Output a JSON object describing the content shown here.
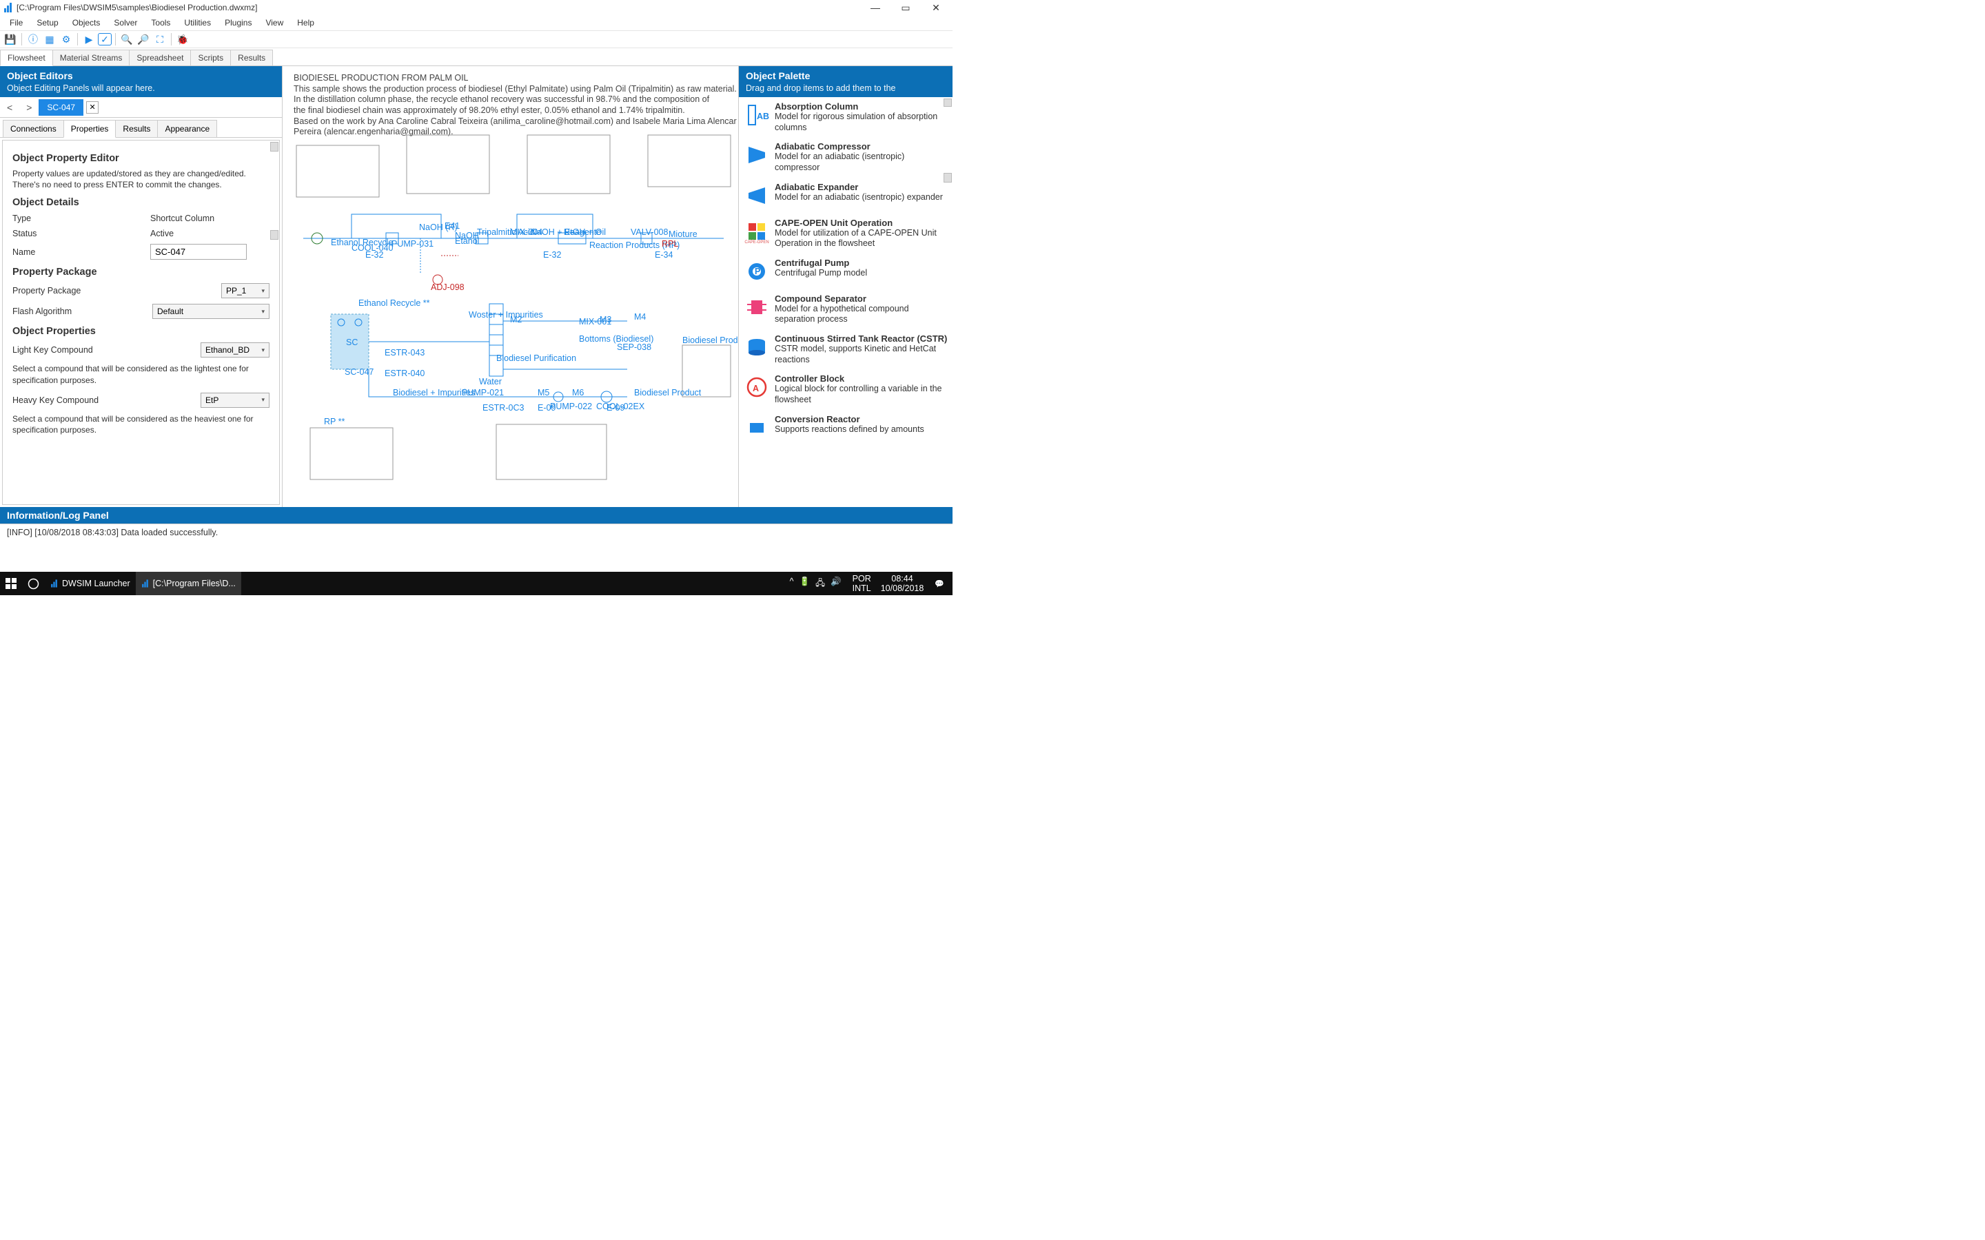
{
  "window": {
    "title": "[C:\\Program Files\\DWSIM5\\samples\\Biodiesel Production.dwxmz]"
  },
  "menu": [
    "File",
    "Setup",
    "Objects",
    "Solver",
    "Tools",
    "Utilities",
    "Plugins",
    "View",
    "Help"
  ],
  "doc_tabs": [
    "Flowsheet",
    "Material Streams",
    "Spreadsheet",
    "Scripts",
    "Results"
  ],
  "doc_active": "Flowsheet",
  "editor": {
    "header": "Object Editors",
    "sub": "Object Editing Panels will appear here.",
    "obj_tab": "SC-047",
    "sub_tabs": [
      "Connections",
      "Properties",
      "Results",
      "Appearance"
    ],
    "sub_active": "Properties",
    "title": "Object Property Editor",
    "help": "Property values are updated/stored as they are changed/edited. There's no need to press ENTER to commit the changes.",
    "details_h": "Object Details",
    "type_l": "Type",
    "type_v": "Shortcut Column",
    "status_l": "Status",
    "status_v": "Active",
    "name_l": "Name",
    "name_v": "SC-047",
    "pkg_h": "Property Package",
    "pkg_l": "Property Package",
    "pkg_v": "PP_1",
    "flash_l": "Flash Algorithm",
    "flash_v": "Default",
    "objprops_h": "Object Properties",
    "lk_l": "Light Key Compound",
    "lk_v": "Ethanol_BD",
    "lk_help": "Select a compound that will be considered as the lightest one for specification purposes.",
    "hk_l": "Heavy Key Compound",
    "hk_v": "EtP",
    "hk_help": "Select a compound that will be considered as the heaviest one for specification purposes."
  },
  "canvas": {
    "title": "BIODIESEL PRODUCTION FROM PALM OIL",
    "l1": "This sample shows the production process of biodiesel (Ethyl Palmitate) using Palm Oil (Tripalmitin) as raw material.",
    "l2": "In the distillation column phase, the recycle ethanol recovery was successful in 98.7% and the composition of",
    "l3": "the final biodiesel chain was approximately of 98.20% ethyl ester, 0.05% ethanol and 1.74% tripalmitin.",
    "l4": "Based on the work by Ana Caroline Cabral Teixeira (anilima_caroline@hotmail.com) and Isabele Maria Lima Alencar Pereira (alencar.engenharia@gmail.com)."
  },
  "palette": {
    "header": "Object Palette",
    "sub": "Drag and drop items to add them to the",
    "items": [
      {
        "t": "Absorption Column",
        "d": "Model for rigorous simulation of absorption columns"
      },
      {
        "t": "Adiabatic Compressor",
        "d": "Model for an adiabatic (isentropic) compressor"
      },
      {
        "t": "Adiabatic Expander",
        "d": "Model for an adiabatic (isentropic) expander"
      },
      {
        "t": "CAPE-OPEN Unit Operation",
        "d": "Model for utilization of a CAPE-OPEN Unit Operation in the flowsheet"
      },
      {
        "t": "Centrifugal Pump",
        "d": "Centrifugal Pump model"
      },
      {
        "t": "Compound Separator",
        "d": "Model for a hypothetical compound separation process"
      },
      {
        "t": "Continuous Stirred Tank Reactor (CSTR)",
        "d": "CSTR model, supports Kinetic and HetCat reactions"
      },
      {
        "t": "Controller Block",
        "d": "Logical block for controlling a variable in the flowsheet"
      },
      {
        "t": "Conversion Reactor",
        "d": "Supports reactions defined by amounts"
      }
    ]
  },
  "log": {
    "header": "Information/Log Panel",
    "line": "[INFO] [10/08/2018 08:43:03] Data loaded successfully."
  },
  "taskbar": {
    "app1": "DWSIM Launcher",
    "app2": "[C:\\Program Files\\D...",
    "lang": "POR",
    "intl": "INTL",
    "time": "08:44",
    "date": "10/08/2018"
  }
}
